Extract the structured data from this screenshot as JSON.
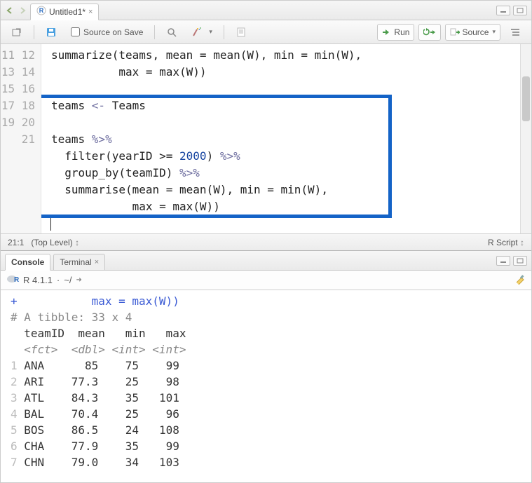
{
  "tabs": {
    "source": {
      "label": "Untitled1*"
    },
    "console": "Console",
    "terminal": "Terminal"
  },
  "toolbar": {
    "source_on_save": "Source on Save",
    "run": "Run",
    "source_btn": "Source"
  },
  "status": {
    "cursor": "21:1",
    "scope": "(Top Level)",
    "lang": "R Script"
  },
  "console_header": {
    "version": "R 4.1.1",
    "path": "~/"
  },
  "code": {
    "lines": {
      "11": "summarize(teams, mean = mean(W), min = min(W),",
      "12": "          max = max(W))",
      "13": "",
      "14_a": "teams ",
      "14_b": "<-",
      "14_c": " Teams",
      "15": "",
      "16_a": "teams ",
      "16_b": "%>%",
      "17_a": "  filter(yearID >= ",
      "17_num": "2000",
      "17_b": ") ",
      "17_pipe": "%>%",
      "18_a": "  group_by(teamID) ",
      "18_pipe": "%>%",
      "19": "  summarise(mean = mean(W), min = min(W),",
      "20": "            max = max(W))",
      "21": ""
    }
  },
  "console": {
    "truncated_top": "          max = max(W))",
    "tibble_header": "# A tibble: 33 x 4",
    "col_header": "  teamID  mean   min   max",
    "col_types": "  <fct>  <dbl> <int> <int>",
    "rows": [
      {
        "idx": "1",
        "team": "ANA",
        "mean": "85",
        "min": "75",
        "max": "99"
      },
      {
        "idx": "2",
        "team": "ARI",
        "mean": "77.3",
        "min": "25",
        "max": "98"
      },
      {
        "idx": "3",
        "team": "ATL",
        "mean": "84.3",
        "min": "35",
        "max": "101"
      },
      {
        "idx": "4",
        "team": "BAL",
        "mean": "70.4",
        "min": "25",
        "max": "96"
      },
      {
        "idx": "5",
        "team": "BOS",
        "mean": "86.5",
        "min": "24",
        "max": "108"
      },
      {
        "idx": "6",
        "team": "CHA",
        "mean": "77.9",
        "min": "35",
        "max": "99"
      },
      {
        "idx": "7",
        "team": "CHN",
        "mean": "79.0",
        "min": "34",
        "max": "103"
      }
    ]
  }
}
